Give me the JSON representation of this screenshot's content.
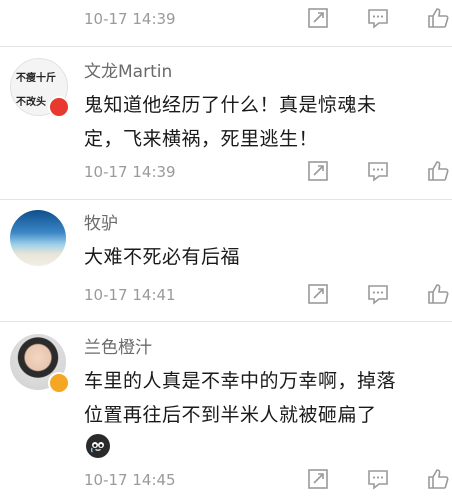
{
  "comments": [
    {
      "time": "10-17 14:39"
    },
    {
      "author": "文龙Martin",
      "avatar_text": [
        "不瘦十斤",
        "不改头"
      ],
      "content_lines": [
        "鬼知道他经历了什么！真是惊魂未",
        "定，飞来横祸，死里逃生！"
      ],
      "time": "10-17 14:39"
    },
    {
      "author": "牧驴",
      "content_lines": [
        "大难不死必有后福"
      ],
      "time": "10-17 14:41"
    },
    {
      "author": "兰色橙汁",
      "content_lines": [
        "车里的人真是不幸中的万幸啊，掉落",
        "位置再往后不到半米人就被砸扁了"
      ],
      "emoji": "crying-face-emoji",
      "time": "10-17 14:45"
    }
  ],
  "icons": {
    "repost": "repost-icon",
    "comment": "comment-icon",
    "like": "thumbs-up-icon"
  },
  "colors": {
    "text": "#1a1a1a",
    "name": "#6a6a6a",
    "meta": "#9a9a9a",
    "icon": "#9a9a9a",
    "verified": "#f5a623",
    "vip_red": "#e8392f"
  }
}
